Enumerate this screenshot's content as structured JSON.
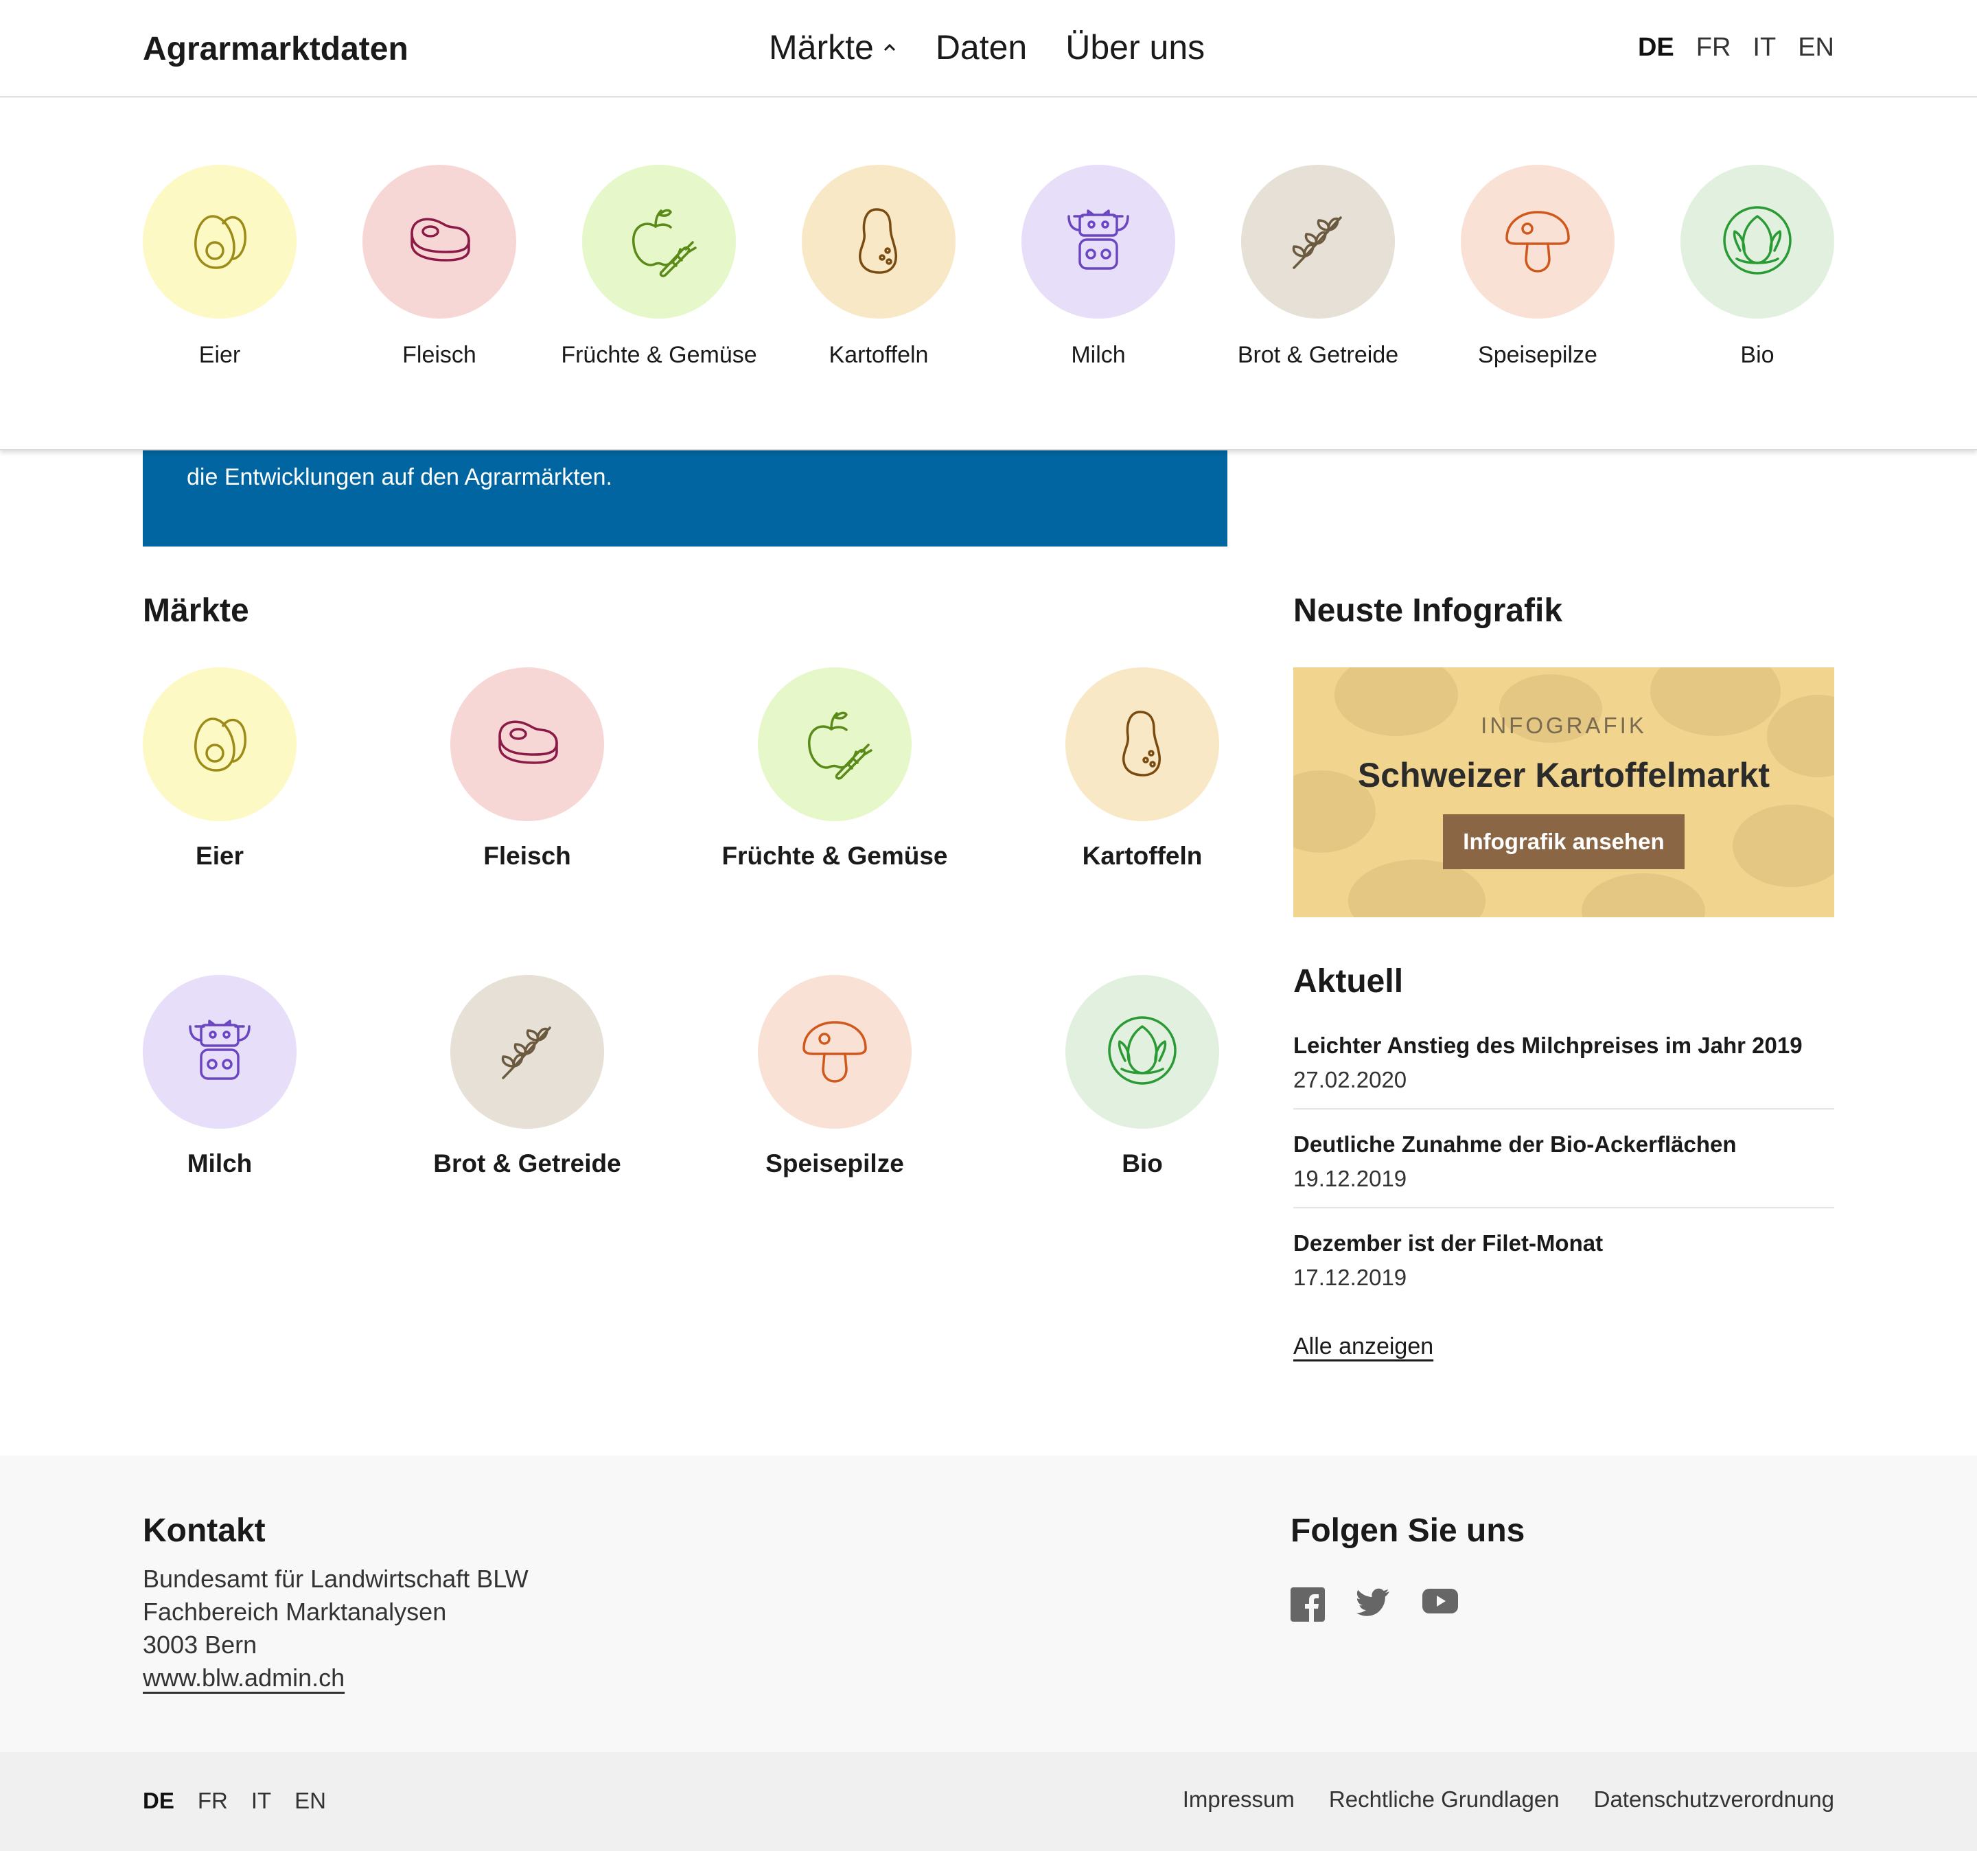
{
  "header": {
    "logo": "Agrarmarktdaten",
    "nav": [
      "Märkte",
      "Daten",
      "Über uns"
    ],
    "languages": [
      "DE",
      "FR",
      "IT",
      "EN"
    ],
    "active_language": "DE"
  },
  "markets": [
    {
      "label": "Eier",
      "icon": "egg-icon",
      "bg": "#fdf9c4",
      "stroke": "#9c8b17"
    },
    {
      "label": "Fleisch",
      "icon": "meat-icon",
      "bg": "#f7d6d6",
      "stroke": "#8b1a46"
    },
    {
      "label": "Früchte & Gemüse",
      "icon": "fruit-vegetable-icon",
      "bg": "#e6f8c9",
      "stroke": "#5a8a17"
    },
    {
      "label": "Kartoffeln",
      "icon": "potato-icon",
      "bg": "#f8e8c6",
      "stroke": "#7a4b10"
    },
    {
      "label": "Milch",
      "icon": "cow-icon",
      "bg": "#e7defa",
      "stroke": "#6a46c0"
    },
    {
      "label": "Brot & Getreide",
      "icon": "grain-icon",
      "bg": "#e6e0d6",
      "stroke": "#6b5a40"
    },
    {
      "label": "Speisepilze",
      "icon": "mushroom-icon",
      "bg": "#f9e1d6",
      "stroke": "#d0581c"
    },
    {
      "label": "Bio",
      "icon": "bio-leaf-icon",
      "bg": "#e1f0df",
      "stroke": "#2a9a34"
    }
  ],
  "hero": {
    "text": "die Entwicklungen auf den Agrarmärkten."
  },
  "markets_section": {
    "title": "Märkte"
  },
  "infografik": {
    "section_title": "Neuste Infografik",
    "tag": "INFOGRAFIK",
    "title": "Schweizer Kartoffelmarkt",
    "button": "Infografik ansehen"
  },
  "aktuell": {
    "title": "Aktuell",
    "items": [
      {
        "title": "Leichter Anstieg des Milchpreises im Jahr 2019",
        "date": "27.02.2020"
      },
      {
        "title": "Deutliche Zunahme der Bio-Ackerflächen",
        "date": "19.12.2019"
      },
      {
        "title": "Dezember ist der Filet-Monat",
        "date": "17.12.2019"
      }
    ],
    "all_link": "Alle anzeigen"
  },
  "footer": {
    "contact_title": "Kontakt",
    "contact_lines": [
      "Bundesamt für Landwirtschaft BLW",
      "Fachbereich Marktanalysen",
      "3003 Bern"
    ],
    "contact_link": "www.blw.admin.ch",
    "follow_title": "Folgen Sie uns",
    "social": [
      "facebook-icon",
      "twitter-icon",
      "youtube-icon"
    ],
    "languages": [
      "DE",
      "FR",
      "IT",
      "EN"
    ],
    "links": [
      "Impressum",
      "Rechtliche Grundlagen",
      "Datenschutzverordnung"
    ]
  }
}
